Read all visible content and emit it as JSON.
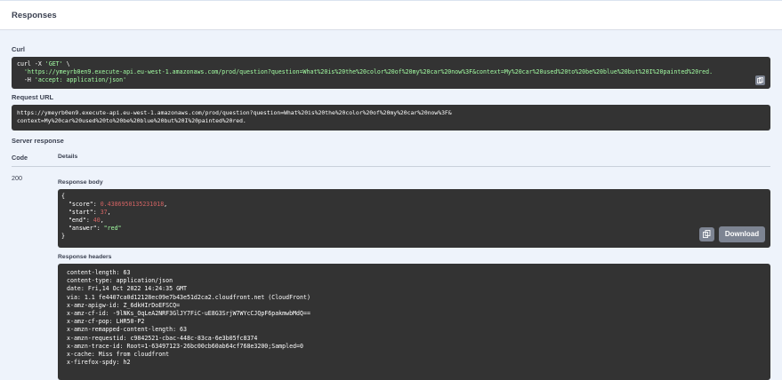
{
  "header": {
    "title": "Responses"
  },
  "curl": {
    "label": "Curl",
    "line1_cmd": "curl -X ",
    "line1_method": "'GET'",
    "line1_tail": " \\",
    "line2_url": "  'https://ymeyrb0en9.execute-api.eu-west-1.amazonaws.com/prod/question?question=What%20is%20the%20color%20of%20my%20car%20now%3F&context=My%20car%20used%20to%20be%20blue%20but%20I%20painted%20red.",
    "line3_flag": "  -H ",
    "line3_header": "'accept: application/json'"
  },
  "request_url": {
    "label": "Request URL",
    "line1": "https://ymeyrb0en9.execute-api.eu-west-1.amazonaws.com/prod/question?question=What%20is%20the%20color%20of%20my%20car%20now%3F&",
    "line2": "context=My%20car%20used%20to%20be%20blue%20but%20I%20painted%20red."
  },
  "server_response": {
    "label": "Server response",
    "code_header": "Code",
    "details_header": "Details",
    "status_code": "200",
    "body_label": "Response body",
    "body": {
      "score_key": "\"score\"",
      "score_val": "0.4386950135231018",
      "start_key": "\"start\"",
      "start_val": "37",
      "end_key": "\"end\"",
      "end_val": "40",
      "answer_key": "\"answer\"",
      "answer_val": "\"red\""
    },
    "download_label": "Download",
    "headers_label": "Response headers",
    "headers": [
      "content-length: 63",
      "content-type: application/json",
      "date: Fri,14 Oct 2022 14:24:35 GMT",
      "via: 1.1 fe4407ca0d12128ec09e7b43e51d2ca2.cloudfront.net (CloudFront)",
      "x-amz-apigw-id: Z_6dkHIrDoEFSCQ=",
      "x-amz-cf-id: -9lNKs_OqLeA2NRF3GlJY7FiC-uE8G3SrjW7WYcCJQpF6pakmwbMdQ==",
      "x-amz-cf-pop: LHR50-P2",
      "x-amzn-remapped-content-length: 63",
      "x-amzn-requestid: c9842521-cbac-448c-83ca-6e3b05fc8374",
      "x-amzn-trace-id: Root=1-63497123-26bc00cb60ab64cf768e3200;Sampled=0",
      "x-cache: Miss from cloudfront",
      "x-firefox-spdy: h2"
    ]
  }
}
